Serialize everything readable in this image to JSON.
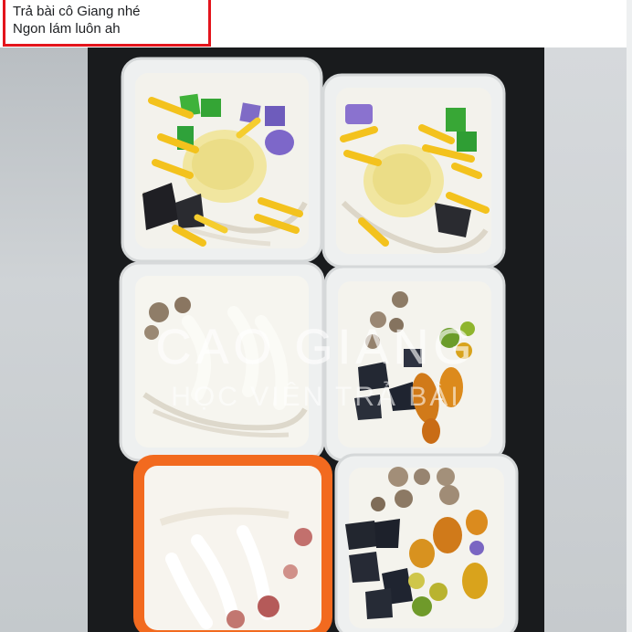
{
  "post": {
    "caption_line1": "Trả bài cô Giang nhé",
    "caption_line2": "Ngon lám luôn ah"
  },
  "photo": {
    "subject": "six containers of coconut milk dessert with jackfruit, jelly and tapioca pearls",
    "watermark_title": "CAO GIANG",
    "watermark_subtitle": "HỌC VIÊN TRẢ BÀI"
  },
  "colors": {
    "highlight_border": "#e3141c",
    "orange_container": "#f26a1f"
  }
}
